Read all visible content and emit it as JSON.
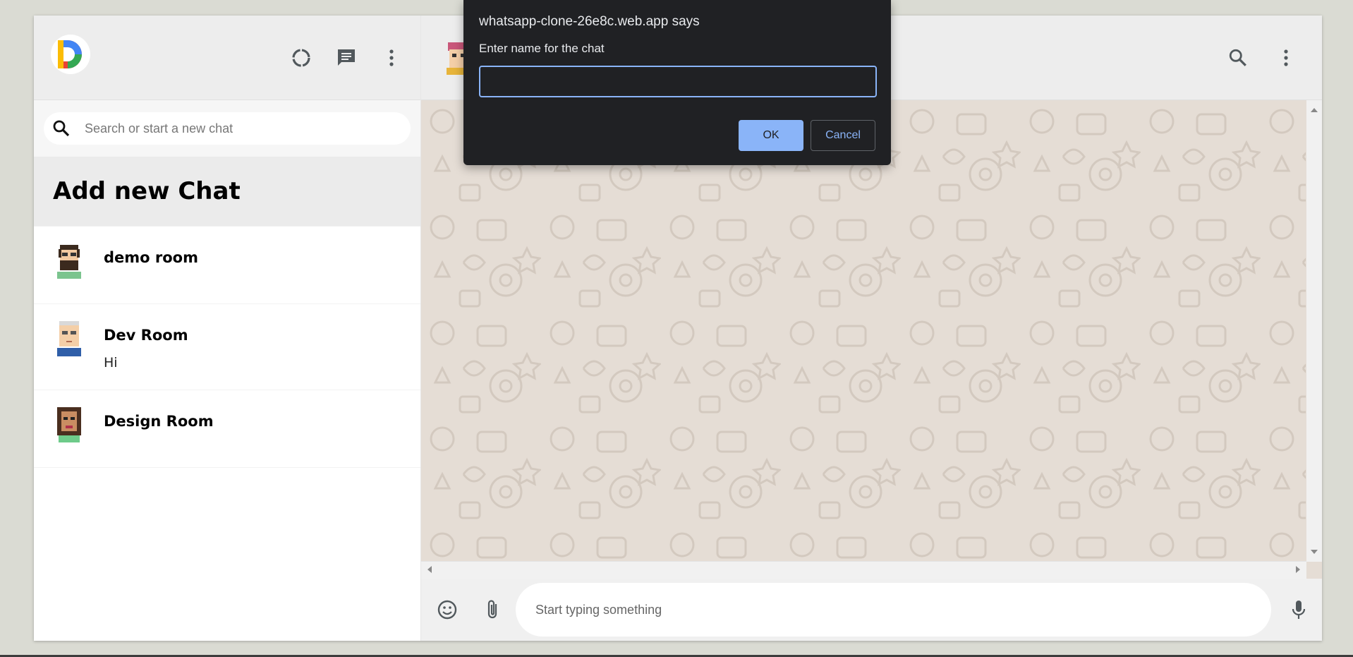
{
  "sidebar": {
    "search_placeholder": "Search or start a new chat",
    "add_chat_label": "Add new Chat",
    "chats": [
      {
        "name": "demo room",
        "last_message": ""
      },
      {
        "name": "Dev Room",
        "last_message": "Hi"
      },
      {
        "name": "Design Room",
        "last_message": ""
      }
    ],
    "header_icons": [
      "status-icon",
      "new-chat-icon",
      "more-vert-icon"
    ]
  },
  "main": {
    "header_icons": [
      "search-icon",
      "more-vert-icon"
    ],
    "message_placeholder": "Start typing something",
    "footer_icons": [
      "emoji-icon",
      "attach-icon",
      "mic-icon"
    ]
  },
  "dialog": {
    "title": "whatsapp-clone-26e8c.web.app says",
    "message": "Enter name for the chat",
    "input_value": "",
    "ok_label": "OK",
    "cancel_label": "Cancel"
  },
  "colors": {
    "page_bg": "#dadbd3",
    "header_bg": "#ededed",
    "chat_bg": "#e5ddd5",
    "dialog_bg": "#202124",
    "dialog_accent": "#8ab4f8"
  }
}
